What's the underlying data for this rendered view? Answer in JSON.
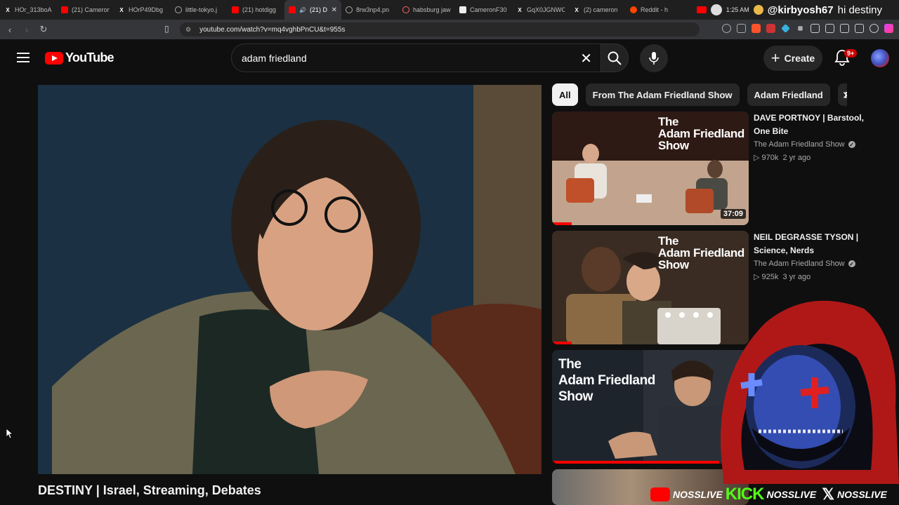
{
  "browser": {
    "tabs": [
      {
        "label": "HOr_313boA",
        "favicon": "x-icon",
        "color": "#000000"
      },
      {
        "label": "(21) Cameron",
        "favicon": "youtube-icon",
        "color": "#ff0000"
      },
      {
        "label": "HOrP49Dbg",
        "favicon": "x-icon",
        "color": "#000000"
      },
      {
        "label": "little-tokyo.j",
        "favicon": "globe-icon",
        "color": "#666666"
      },
      {
        "label": "(21) hotdigg",
        "favicon": "youtube-icon",
        "color": "#ff0000"
      },
      {
        "label": "(21) D",
        "favicon": "youtube-icon",
        "color": "#ff0000",
        "active": true
      },
      {
        "label": "8rw3np4.pn",
        "favicon": "globe-icon",
        "color": "#666666"
      },
      {
        "label": "habsburg jaw",
        "favicon": "search-icon",
        "color": "#666666"
      },
      {
        "label": "CameronF30",
        "favicon": "page-icon",
        "color": "#ffffff"
      },
      {
        "label": "GqX0JGNWC",
        "favicon": "x-icon",
        "color": "#000000"
      },
      {
        "label": "(2) cameron",
        "favicon": "x-icon",
        "color": "#000000"
      },
      {
        "label": "Reddit - h",
        "favicon": "reddit-icon",
        "color": "#ff4500"
      }
    ],
    "time": "1:25 AM",
    "chat_handle": "@kirbyosh67",
    "chat_message": "hi destiny",
    "url": "youtube.com/watch?v=mq4vghbPnCU&t=955s"
  },
  "youtube": {
    "logo_text": "YouTube",
    "search_value": "adam friedland",
    "create_label": "Create",
    "notifications_badge": "9+",
    "video_title": "DESTINY | Israel, Streaming, Debates",
    "chips": [
      "All",
      "From The Adam Friedland Show",
      "Adam Friedland",
      "Po"
    ],
    "thumb_brand": "The\nAdam Friedland\nShow",
    "recommendations": [
      {
        "title": "DAVE PORTNOY | Barstool, One Bite",
        "channel": "The Adam Friedland Show",
        "views": "970k",
        "age": "2 yr ago",
        "duration": "37:09",
        "progress": 0.1
      },
      {
        "title": "NEIL DEGRASSE TYSON | Science, Nerds",
        "channel": "The Adam Friedland Show",
        "views": "925k",
        "age": "3 yr ago",
        "duration": "",
        "progress": 0.1
      },
      {
        "title": "",
        "channel": "",
        "views": "",
        "age": "",
        "duration": "",
        "progress": 0.85
      }
    ]
  },
  "stream_overlay": {
    "handle_1": "NOSSLIVE",
    "kick_logo": "KICK",
    "handle_2": "NOSSLIVE",
    "handle_3": "NOSSLIVE"
  },
  "colors": {
    "accent": "#ff0000",
    "kick": "#53fc18",
    "background": "#0f0f0f"
  }
}
